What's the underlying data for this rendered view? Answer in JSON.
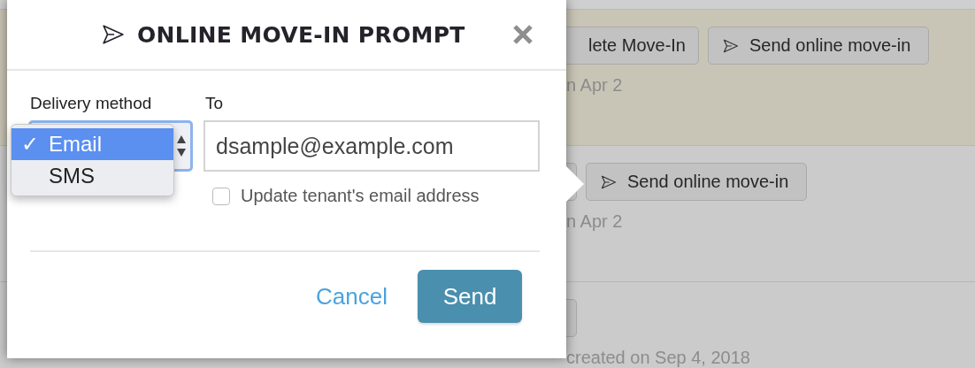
{
  "dialog": {
    "title": "ONLINE MOVE-IN PROMPT",
    "delivery_label": "Delivery method",
    "to_label": "To",
    "delivery_options": [
      {
        "label": "Email",
        "selected": true,
        "check": "✓"
      },
      {
        "label": "SMS",
        "selected": false
      }
    ],
    "to_value": "dsample@example.com",
    "update_checkbox": {
      "label": "Update tenant's email address",
      "checked": false
    },
    "cancel": "Cancel",
    "send": "Send"
  },
  "background_rows": [
    {
      "highlighted": true,
      "buttons": [
        {
          "kind": "plain",
          "label": "lete Move-In"
        },
        {
          "kind": "send",
          "label": "Send online move-in"
        }
      ],
      "note": "n Apr 2"
    },
    {
      "highlighted": false,
      "buttons": [
        {
          "kind": "stub"
        },
        {
          "kind": "send",
          "label": "Send online move-in"
        }
      ],
      "note": "n Apr 2"
    },
    {
      "highlighted": false,
      "buttons": [
        {
          "kind": "stub"
        }
      ],
      "note": "created on Sep 4, 2018"
    }
  ]
}
